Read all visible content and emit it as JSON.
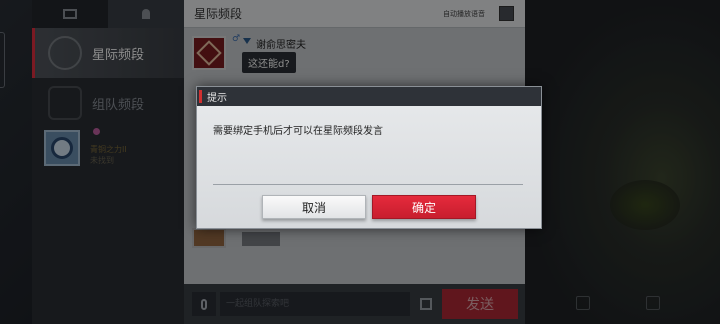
{
  "sidebar": {
    "channels": [
      {
        "label": "星际频段",
        "active": true
      },
      {
        "label": "组队频段",
        "active": false
      }
    ],
    "friend": {
      "line1": "青铜之力II",
      "line2": "未找到"
    }
  },
  "panel": {
    "title": "星际频段",
    "autoplay_label": "自动播放语音",
    "message": {
      "sender": "谢俞思密夫",
      "gender": "♂",
      "text": "这还能d?"
    },
    "input_placeholder": "一起组队探索吧",
    "send_label": "发送"
  },
  "dialog": {
    "title": "提示",
    "message": "需要绑定手机后才可以在星际频段发言",
    "cancel_label": "取消",
    "confirm_label": "确定"
  },
  "colors": {
    "accent_red": "#d9283a",
    "panel_bg": "#c9ccd0",
    "dialog_header": "#2e3238"
  }
}
